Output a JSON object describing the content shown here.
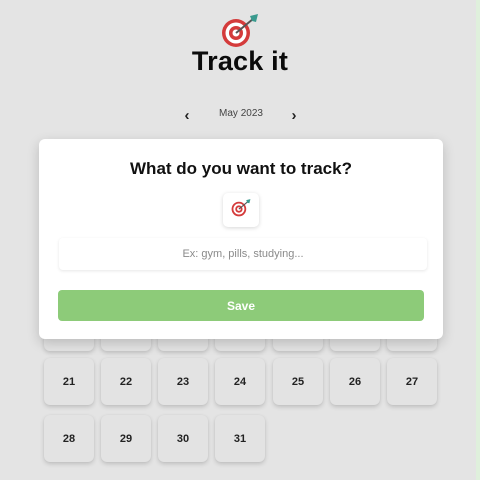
{
  "app": {
    "title": "Track it",
    "logo_icon": "dart-target-icon"
  },
  "month_nav": {
    "prev_icon": "chevron-left-icon",
    "prev_label": "‹",
    "label": "May 2023",
    "next_icon": "chevron-right-icon",
    "next_label": "›"
  },
  "calendar": {
    "week_4": [
      "21",
      "22",
      "23",
      "24",
      "25",
      "26",
      "27"
    ],
    "week_5": [
      "28",
      "29",
      "30",
      "31"
    ]
  },
  "modal": {
    "title": "What do you want to track?",
    "emoji_icon": "dart-target-icon",
    "input_value": "",
    "input_placeholder": "Ex: gym, pills, studying...",
    "save_label": "Save"
  },
  "colors": {
    "background": "#e4e4e4",
    "card": "#ffffff",
    "save_button": "#8dcb79",
    "day_tile": "#e3e3e3",
    "target_red": "#d43b3b",
    "dart_teal": "#3a9a8e"
  }
}
